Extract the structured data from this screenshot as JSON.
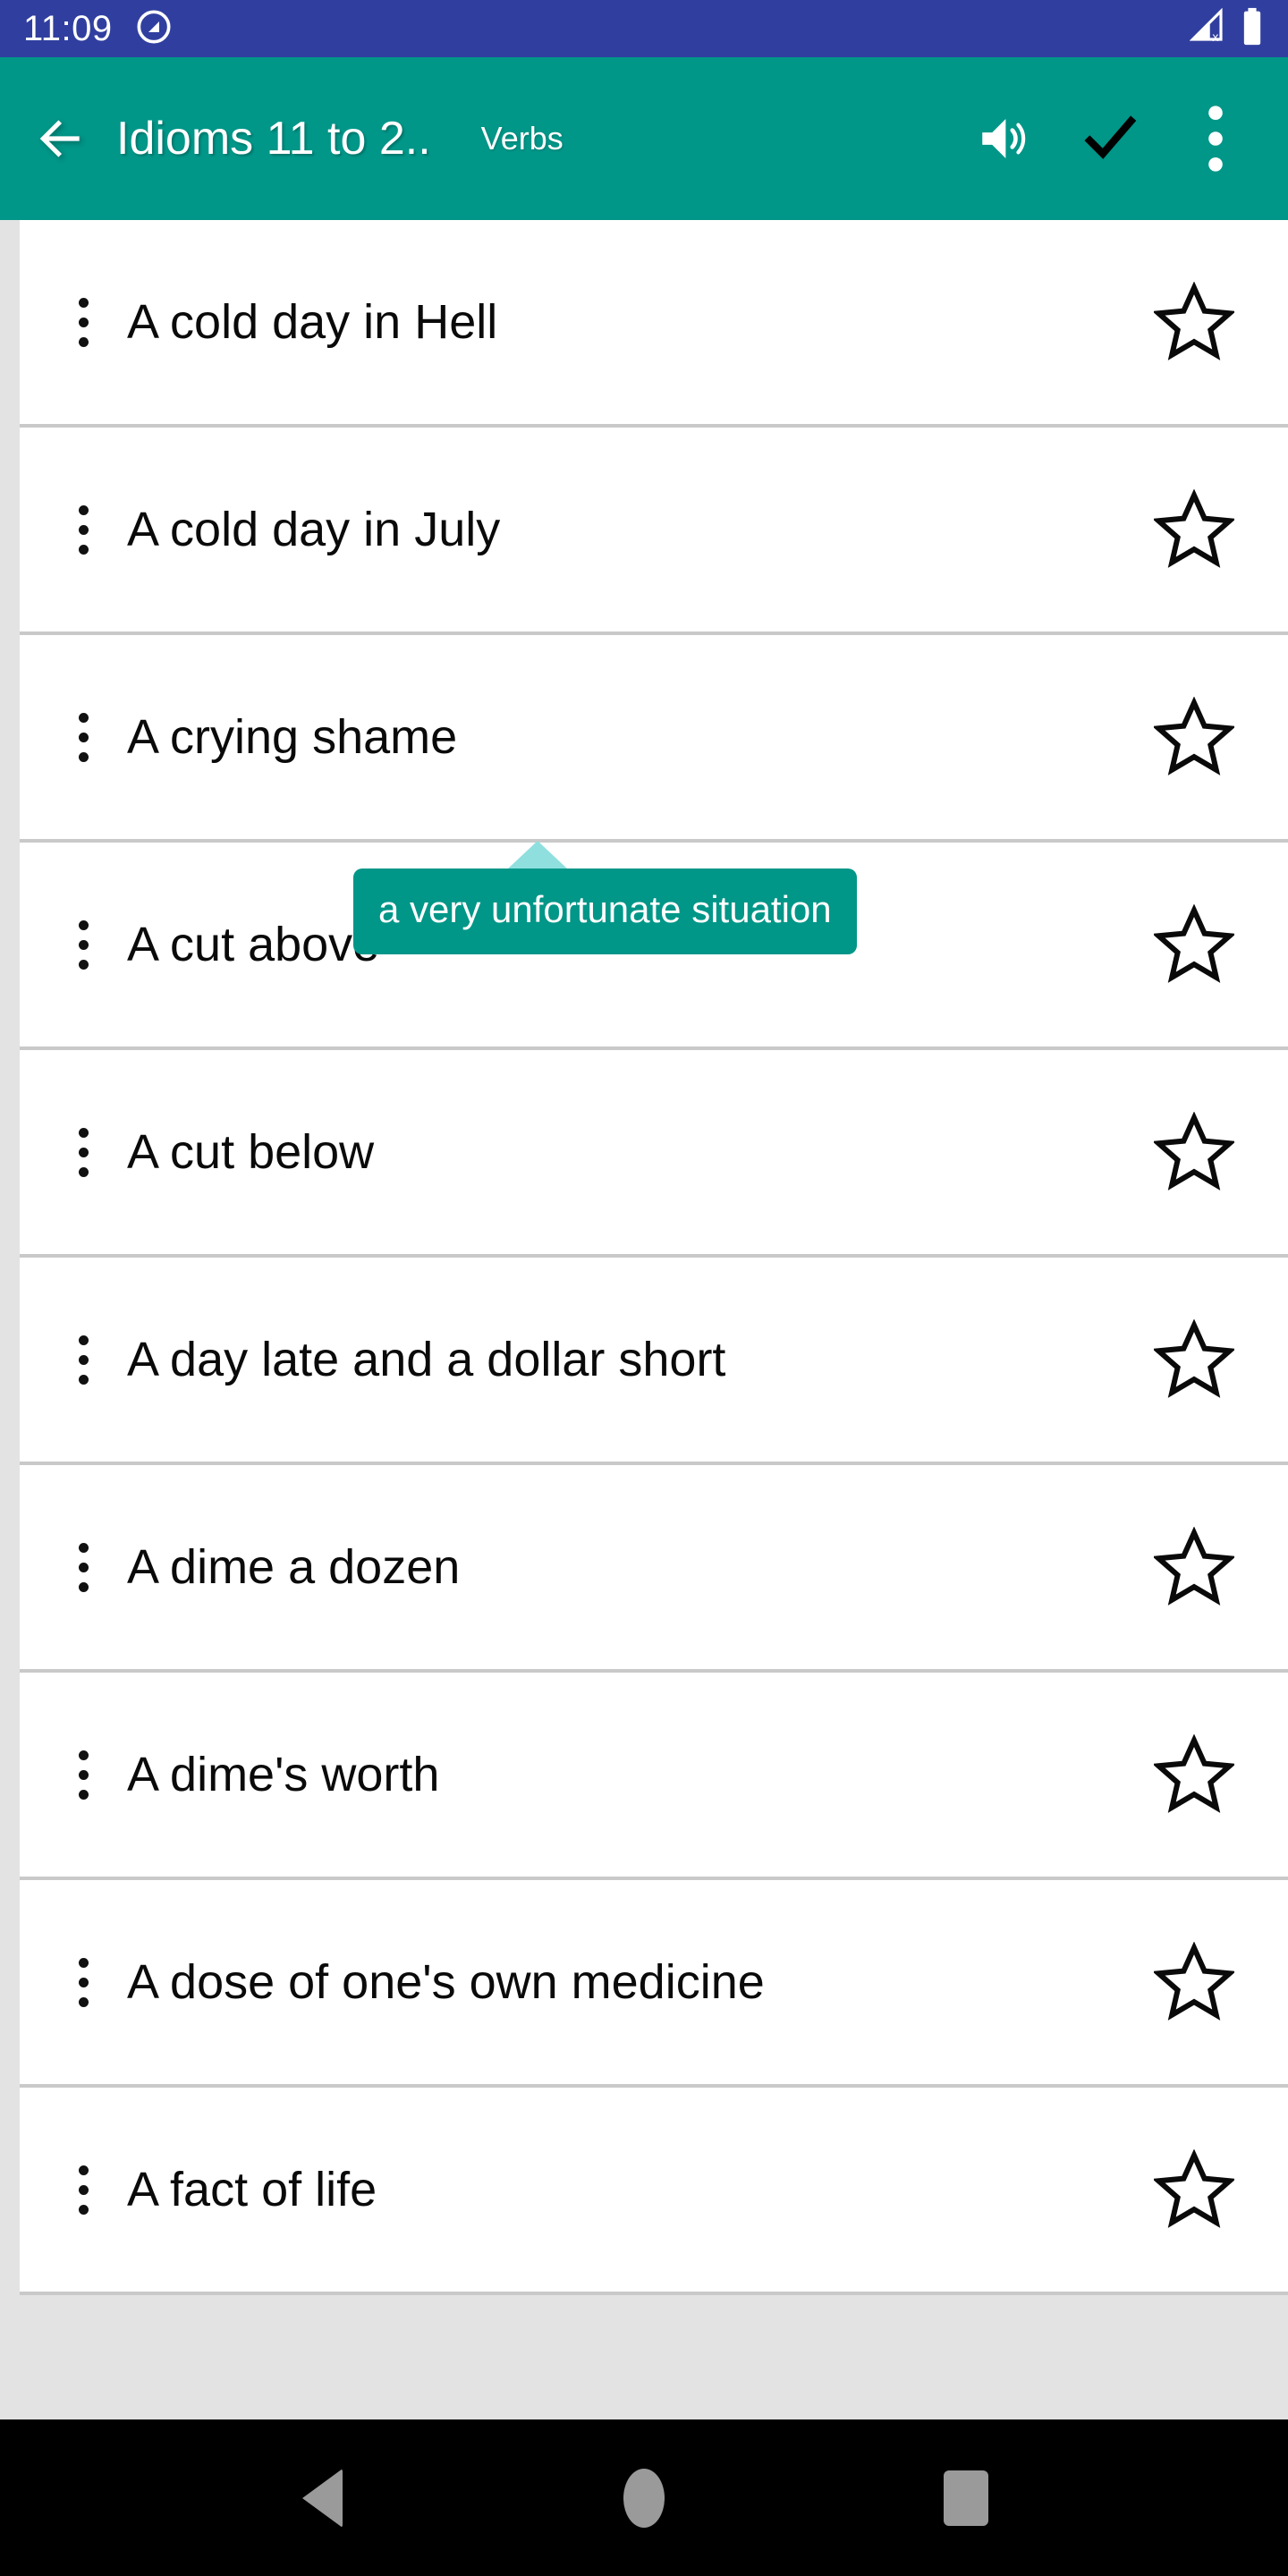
{
  "colors": {
    "status_bar_bg": "#303f9f",
    "toolbar_bg": "#009688",
    "tooltip_bg": "#009688",
    "tooltip_arrow": "#8fdfdf",
    "list_bg": "#e3e3e3",
    "row_bg": "#ffffff",
    "divider": "#c9c9c9",
    "nav_bg": "#000000",
    "nav_icon": "#9a9a9a",
    "check_icon": "#000000"
  },
  "status_bar": {
    "time": "11:09",
    "notification_icon": "app-notification-icon",
    "signal_icon": "no-sim-signal-icon",
    "battery_icon": "battery-full-icon"
  },
  "toolbar": {
    "back_icon": "arrow-back-icon",
    "title": "Idioms 11 to 2..",
    "subtitle": "Verbs",
    "speaker_icon": "volume-up-icon",
    "check_icon": "check-icon",
    "overflow_icon": "more-vert-icon"
  },
  "tooltip": {
    "text": "a very unfortunate situation",
    "anchor_row_index": 2
  },
  "list": {
    "row_menu_icon": "more-vert-icon",
    "row_star_icon": "star-outline-icon",
    "items": [
      {
        "text": "A cold day in Hell",
        "starred": false
      },
      {
        "text": "A cold day in July",
        "starred": false
      },
      {
        "text": "A crying shame",
        "starred": false
      },
      {
        "text": "A cut above",
        "starred": false
      },
      {
        "text": "A cut below",
        "starred": false
      },
      {
        "text": "A day late and a dollar short",
        "starred": false
      },
      {
        "text": "A dime a dozen",
        "starred": false
      },
      {
        "text": "A dime's worth",
        "starred": false
      },
      {
        "text": "A dose of one's own medicine",
        "starred": false
      },
      {
        "text": "A fact of life",
        "starred": false
      }
    ]
  },
  "navbar": {
    "back_label": "Back",
    "home_label": "Home",
    "recents_label": "Recents"
  }
}
